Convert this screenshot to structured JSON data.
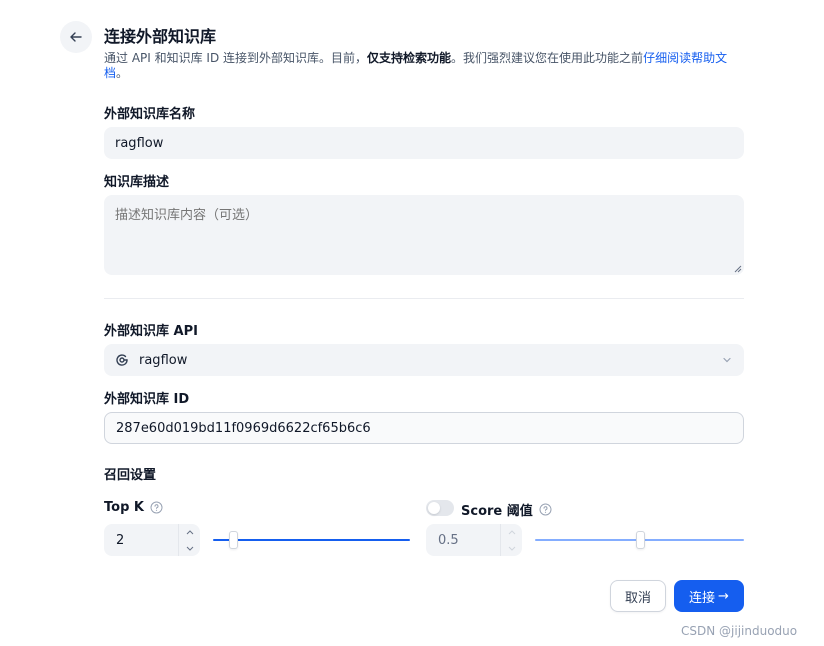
{
  "header": {
    "title": "连接外部知识库",
    "description_pre": "通过 API 和知识库 ID 连接到外部知识库。目前，",
    "description_strong": "仅支持检索功能",
    "description_mid": "。我们强烈建议您在使用此功能之前",
    "description_link": "仔细阅读帮助文档",
    "description_post": "。"
  },
  "form": {
    "name_label": "外部知识库名称",
    "name_value": "ragflow",
    "desc_label": "知识库描述",
    "desc_placeholder": "描述知识库内容（可选）",
    "api_label": "外部知识库 API",
    "api_value": "ragflow",
    "id_label": "外部知识库 ID",
    "id_value": "287e60d019bd11f0969d6622cf65b6c6"
  },
  "retrieval": {
    "section_label": "召回设置",
    "top_k_label": "Top K",
    "top_k_value": "2",
    "top_k_fraction": 0.1,
    "score_label": "Score 阈值",
    "score_value": "0.5",
    "score_fraction": 0.5,
    "score_enabled": false
  },
  "footer": {
    "cancel_label": "取消",
    "connect_label": "连接",
    "connect_arrow": "→"
  },
  "watermark": "CSDN @jijinduoduo",
  "colors": {
    "primary": "#155eef",
    "field_bg": "#f2f4f7",
    "text": "#101828"
  }
}
